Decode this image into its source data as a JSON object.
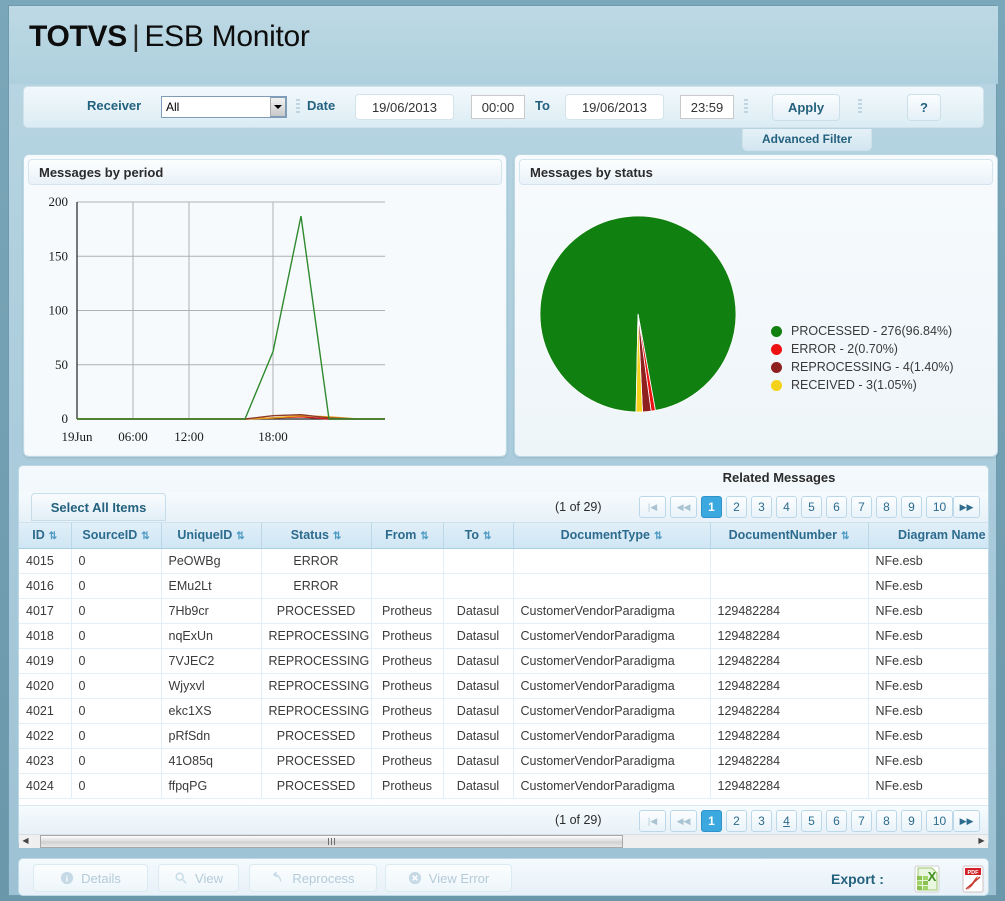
{
  "app": {
    "brand_bold": "TOTVS",
    "brand_sep": "|",
    "brand_light": "ESB Monitor"
  },
  "filter": {
    "receiver_label": "Receiver",
    "receiver_value": "All",
    "date_label": "Date",
    "date_from": "19/06/2013",
    "time_from": "00:00",
    "to_label": "To",
    "date_to": "19/06/2013",
    "time_to": "23:59",
    "apply_label": "Apply",
    "help_label": "?",
    "advanced_filter_label": "Advanced Filter"
  },
  "panels": {
    "period_title": "Messages by period",
    "status_title": "Messages by status"
  },
  "chart_data": [
    {
      "type": "line",
      "title": "Messages by period",
      "xlabel": "",
      "ylabel": "",
      "ylim": [
        0,
        200
      ],
      "yticks": [
        0,
        50,
        100,
        150,
        200
      ],
      "xticks": [
        "19Jun",
        "06:00",
        "12:00",
        "18:00"
      ],
      "grid": true,
      "legend": "none",
      "x": [
        "19Jun",
        "03:00",
        "06:00",
        "09:00",
        "12:00",
        "15:00",
        "17:15",
        "18:00",
        "18:40",
        "19:15",
        "21:00",
        "23:59"
      ],
      "series": [
        {
          "name": "PROCESSED",
          "color": "#2f8a2f",
          "values": [
            0,
            0,
            0,
            0,
            0,
            0,
            0,
            62,
            187,
            0,
            0,
            0
          ]
        },
        {
          "name": "REPROCESSING",
          "color": "#8f3b2a",
          "values": [
            0,
            0,
            0,
            0,
            0,
            0,
            0,
            3,
            4,
            1,
            0,
            0
          ]
        },
        {
          "name": "RECEIVED",
          "color": "#e8a617",
          "values": [
            0,
            0,
            0,
            0,
            0,
            0,
            0,
            1,
            3,
            2,
            0,
            0
          ]
        },
        {
          "name": "ERROR",
          "color": "#cc2222",
          "values": [
            0,
            0,
            0,
            0,
            0,
            0,
            0,
            1,
            2,
            0,
            0,
            0
          ]
        }
      ]
    },
    {
      "type": "pie",
      "title": "Messages by status",
      "labels": [
        "PROCESSED",
        "ERROR",
        "REPROCESSING",
        "RECEIVED"
      ],
      "values": [
        276,
        2,
        4,
        3
      ],
      "percents": [
        "96.84%",
        "0.70%",
        "1.40%",
        "1.05%"
      ],
      "colors": [
        "#108010",
        "#ee1111",
        "#8f2020",
        "#f5d21a"
      ],
      "legend": "right",
      "legend_entries": [
        {
          "label": "PROCESSED - 276(96.84%)",
          "color": "#108010"
        },
        {
          "label": "ERROR - 2(0.70%)",
          "color": "#ee1111"
        },
        {
          "label": "REPROCESSING - 4(1.40%)",
          "color": "#8f2020"
        },
        {
          "label": "RECEIVED - 3(1.05%)",
          "color": "#f5d21a"
        }
      ]
    }
  ],
  "grid": {
    "related_title": "Related Messages",
    "select_all_label": "Select All Items",
    "pager_count": "(1 of 29)",
    "pages": [
      "1",
      "2",
      "3",
      "4",
      "5",
      "6",
      "7",
      "8",
      "9",
      "10"
    ],
    "active_page": "1",
    "bottom_underlined_page": "4",
    "nav_first": "|◀",
    "nav_prev": "◀◀",
    "nav_last": "▶▶",
    "columns": [
      "ID",
      "SourceID",
      "UniqueID",
      "Status",
      "From",
      "To",
      "DocumentType",
      "DocumentNumber",
      "Diagram Name"
    ],
    "rows": [
      {
        "id": "4015",
        "sourceid": "0",
        "uniqueid": "PeOWBg",
        "status": "ERROR",
        "from": "",
        "to": "",
        "doctype": "",
        "docnumber": "",
        "diagram": "NFe.esb"
      },
      {
        "id": "4016",
        "sourceid": "0",
        "uniqueid": "EMu2Lt",
        "status": "ERROR",
        "from": "",
        "to": "",
        "doctype": "",
        "docnumber": "",
        "diagram": "NFe.esb"
      },
      {
        "id": "4017",
        "sourceid": "0",
        "uniqueid": "7Hb9cr",
        "status": "PROCESSED",
        "from": "Protheus",
        "to": "Datasul",
        "doctype": "CustomerVendorParadigma",
        "docnumber": "129482284",
        "diagram": "NFe.esb"
      },
      {
        "id": "4018",
        "sourceid": "0",
        "uniqueid": "nqExUn",
        "status": "REPROCESSING",
        "from": "Protheus",
        "to": "Datasul",
        "doctype": "CustomerVendorParadigma",
        "docnumber": "129482284",
        "diagram": "NFe.esb"
      },
      {
        "id": "4019",
        "sourceid": "0",
        "uniqueid": "7VJEC2",
        "status": "REPROCESSING",
        "from": "Protheus",
        "to": "Datasul",
        "doctype": "CustomerVendorParadigma",
        "docnumber": "129482284",
        "diagram": "NFe.esb"
      },
      {
        "id": "4020",
        "sourceid": "0",
        "uniqueid": "Wjyxvl",
        "status": "REPROCESSING",
        "from": "Protheus",
        "to": "Datasul",
        "doctype": "CustomerVendorParadigma",
        "docnumber": "129482284",
        "diagram": "NFe.esb"
      },
      {
        "id": "4021",
        "sourceid": "0",
        "uniqueid": "ekc1XS",
        "status": "REPROCESSING",
        "from": "Protheus",
        "to": "Datasul",
        "doctype": "CustomerVendorParadigma",
        "docnumber": "129482284",
        "diagram": "NFe.esb"
      },
      {
        "id": "4022",
        "sourceid": "0",
        "uniqueid": "pRfSdn",
        "status": "PROCESSED",
        "from": "Protheus",
        "to": "Datasul",
        "doctype": "CustomerVendorParadigma",
        "docnumber": "129482284",
        "diagram": "NFe.esb"
      },
      {
        "id": "4023",
        "sourceid": "0",
        "uniqueid": "41O85q",
        "status": "PROCESSED",
        "from": "Protheus",
        "to": "Datasul",
        "doctype": "CustomerVendorParadigma",
        "docnumber": "129482284",
        "diagram": "NFe.esb"
      },
      {
        "id": "4024",
        "sourceid": "0",
        "uniqueid": "ffpqPG",
        "status": "PROCESSED",
        "from": "Protheus",
        "to": "Datasul",
        "doctype": "CustomerVendorParadigma",
        "docnumber": "129482284",
        "diagram": "NFe.esb"
      }
    ]
  },
  "footer": {
    "details_label": "Details",
    "view_label": "View",
    "reprocess_label": "Reprocess",
    "view_error_label": "View Error",
    "export_label": "Export :"
  },
  "colors": {
    "accent": "#24617e",
    "page_active": "#3ba8e0",
    "processed": "#108010",
    "error": "#ee1111",
    "reprocessing": "#8f2020",
    "received": "#f5d21a"
  }
}
